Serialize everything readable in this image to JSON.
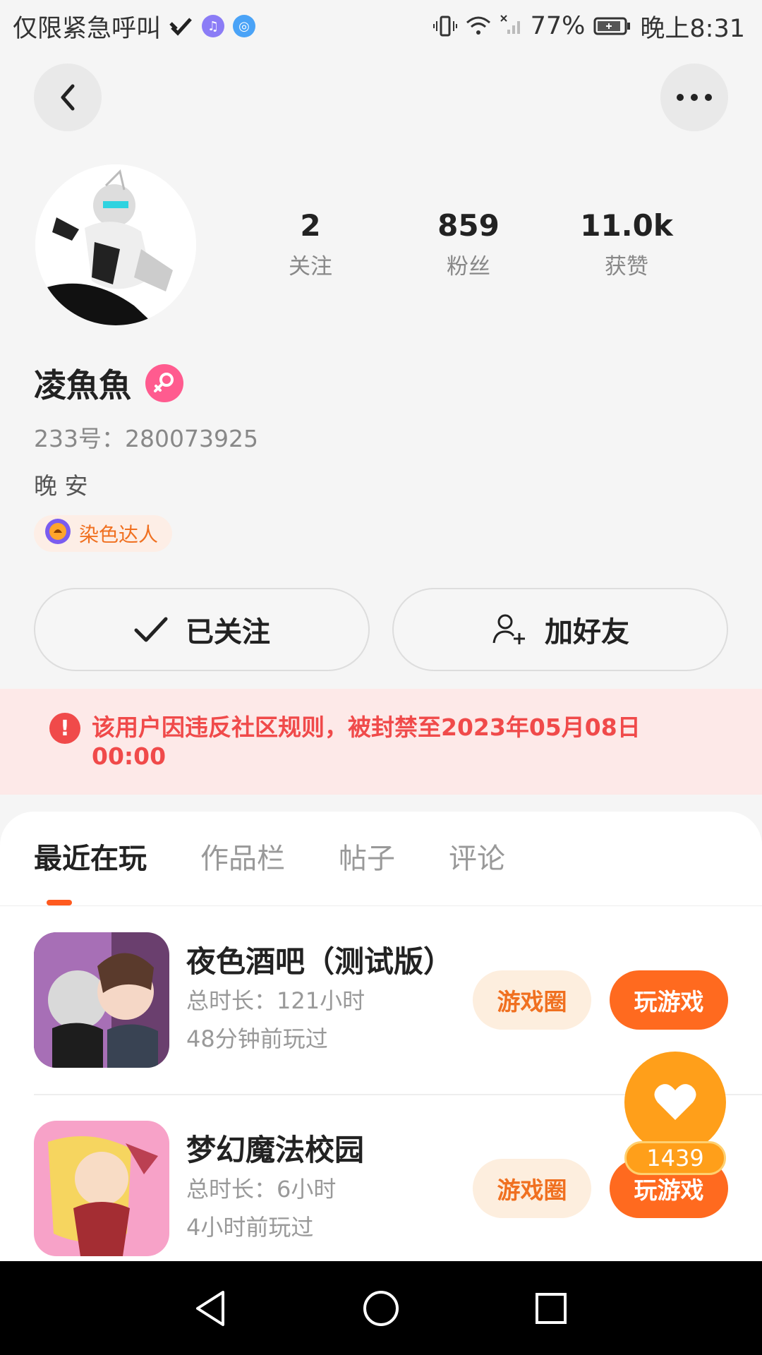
{
  "status_bar": {
    "emergency_text": "仅限紧急呼叫",
    "battery": "77%",
    "time": "晚上8:31",
    "icons": [
      "signal-check-icon",
      "music-icon",
      "browser-icon",
      "vibrate-icon",
      "wifi-icon",
      "no-signal-icon",
      "battery-icon"
    ]
  },
  "nav": {
    "back_icon": "chevron-left-icon",
    "more_icon": "more-horizontal-icon"
  },
  "profile": {
    "stats": [
      {
        "value": "2",
        "label": "关注"
      },
      {
        "value": "859",
        "label": "粉丝"
      },
      {
        "value": "11.0k",
        "label": "获赞"
      }
    ],
    "username": "凌魚魚",
    "gender_icon": "female-icon",
    "user_id": "233号：280073925",
    "bio": "晚 安",
    "achievement_label": "染色达人",
    "achievement_icon": "badge-icon"
  },
  "actions": {
    "following_label": "已关注",
    "add_friend_label": "加好友"
  },
  "notice": {
    "text": "该用户因违反社区规则，被封禁至2023年05月08日 00:00",
    "color": "#f04a4a"
  },
  "tabs": [
    {
      "label": "最近在玩",
      "active": true
    },
    {
      "label": "作品栏",
      "active": false
    },
    {
      "label": "帖子",
      "active": false
    },
    {
      "label": "评论",
      "active": false
    }
  ],
  "games": [
    {
      "title": "夜色酒吧（测试版）",
      "total_time": "总时长：121小时",
      "last_played": "48分钟前玩过",
      "circle_label": "游戏圈",
      "play_label": "玩游戏"
    },
    {
      "title": "梦幻魔法校园",
      "total_time": "总时长：6小时",
      "last_played": "4小时前玩过",
      "circle_label": "游戏圈",
      "play_label": "玩游戏"
    }
  ],
  "fab": {
    "icon": "heart-icon",
    "count": "1439"
  },
  "colors": {
    "accent_orange": "#ff6a1f",
    "background": "#f5f5f5",
    "notice_bg": "#fde9e8"
  }
}
